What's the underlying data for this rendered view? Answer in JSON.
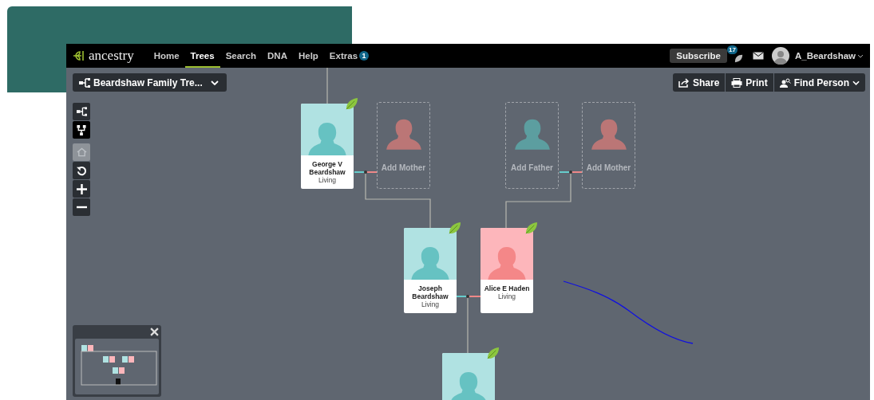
{
  "nav": {
    "logo": "ancestry",
    "items": [
      {
        "label": "Home",
        "selected": false
      },
      {
        "label": "Trees",
        "selected": true
      },
      {
        "label": "Search",
        "selected": false
      },
      {
        "label": "DNA",
        "selected": false
      },
      {
        "label": "Help",
        "selected": false
      },
      {
        "label": "Extras",
        "selected": false,
        "badge": "1"
      }
    ],
    "subscribe": "Subscribe",
    "notifications": "17",
    "user": "A_Beardshaw"
  },
  "toolbar": {
    "tree_name": "Beardshaw Family Tre...",
    "actions": [
      {
        "kind": "share",
        "label": "Share"
      },
      {
        "kind": "print",
        "label": "Print"
      },
      {
        "kind": "find",
        "label": "Find Person"
      }
    ]
  },
  "view_buttons": [
    {
      "kind": "horizontal",
      "selected": false
    },
    {
      "kind": "vertical",
      "selected": true
    }
  ],
  "map_controls": [
    {
      "kind": "home",
      "disabled": true
    },
    {
      "kind": "reset",
      "disabled": false
    },
    {
      "kind": "zoom-in",
      "disabled": false
    },
    {
      "kind": "zoom-out",
      "disabled": false
    }
  ],
  "people": [
    {
      "kind": "male",
      "name": "George V Beardshaw",
      "status": "Living",
      "hint": true
    },
    {
      "kind": "female-placeholder",
      "label": "Add Mother"
    },
    {
      "kind": "male-placeholder",
      "label": "Add Father"
    },
    {
      "kind": "female-placeholder",
      "label": "Add Mother"
    },
    {
      "kind": "male",
      "name": "Joseph Beardshaw",
      "status": "Living",
      "hint": true
    },
    {
      "kind": "female",
      "name": "Alice E Haden",
      "status": "Living",
      "hint": true
    },
    {
      "kind": "male",
      "hint": true
    }
  ]
}
